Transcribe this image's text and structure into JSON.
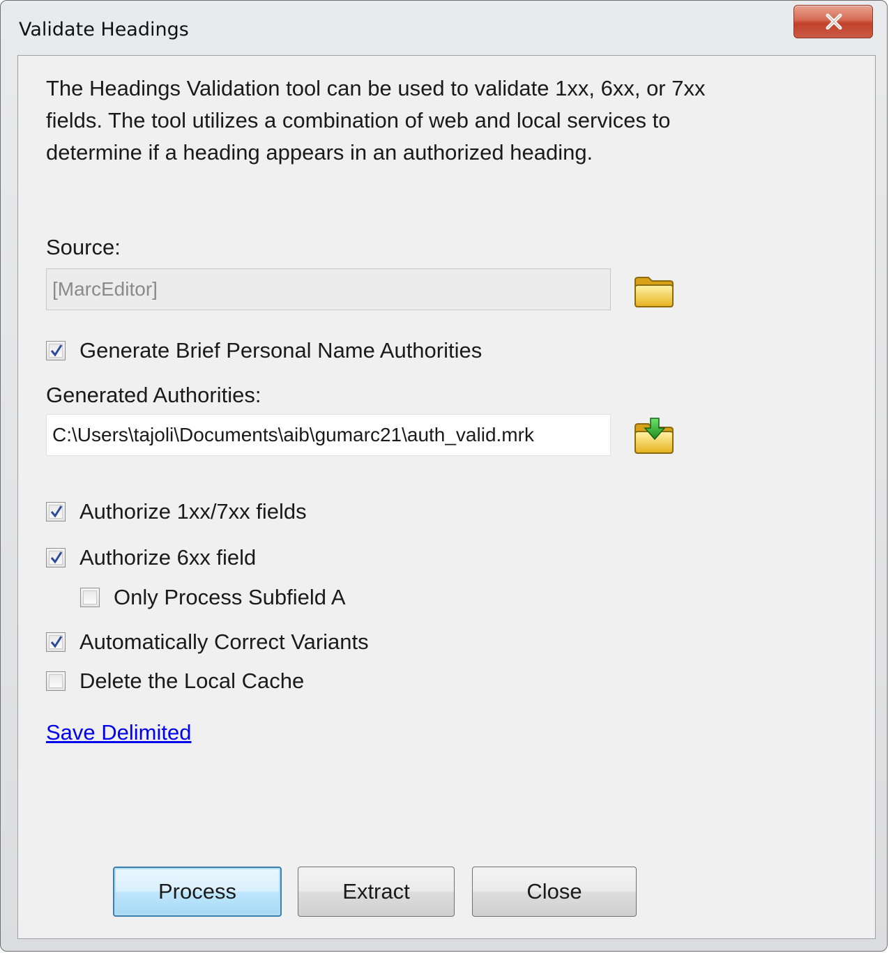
{
  "window": {
    "title": "Validate Headings",
    "close_icon": "close-x-icon"
  },
  "description": "The Headings Validation tool can be used to validate 1xx, 6xx, or 7xx\nfields.  The tool utilizes a combination of web and local services to\ndetermine if a heading appears in an authorized heading.",
  "source": {
    "label": "Source:",
    "value": "[MarcEditor]",
    "browse_icon": "folder-icon"
  },
  "options": {
    "generate_brief": {
      "label": "Generate Brief Personal Name Authorities",
      "checked": true
    },
    "authorize_1xx_7xx": {
      "label": "Authorize 1xx/7xx fields",
      "checked": true
    },
    "authorize_6xx": {
      "label": "Authorize 6xx field",
      "checked": true
    },
    "only_subfield_a": {
      "label": "Only Process Subfield A",
      "checked": false
    },
    "auto_correct": {
      "label": "Automatically Correct Variants",
      "checked": true
    },
    "delete_cache": {
      "label": "Delete the Local Cache",
      "checked": false
    }
  },
  "generated_authorities": {
    "label": "Generated Authorities:",
    "value": "C:\\Users\\tajoli\\Documents\\aib\\gumarc21\\auth_valid.mrk",
    "save_icon": "folder-save-icon"
  },
  "links": {
    "save_delimited": "Save Delimited"
  },
  "buttons": {
    "process": "Process",
    "extract": "Extract",
    "close": "Close"
  }
}
